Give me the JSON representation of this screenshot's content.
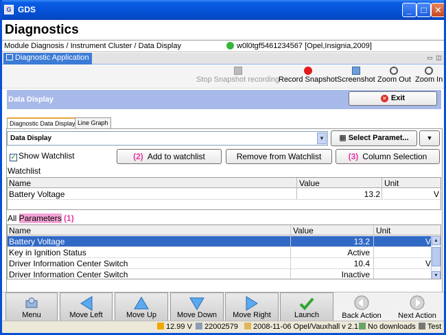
{
  "window": {
    "title": "GDS",
    "app_icon": "app-icon"
  },
  "header": {
    "title": "Diagnostics",
    "breadcrumb": "Module Diagnosis / Instrument Cluster / Data Display",
    "vehicle": "w0l0tgf5461234567 [Opel,Insignia,2009]"
  },
  "app_tab": {
    "label": "Diagnostic Application"
  },
  "toolbar": {
    "stop_snapshot": "Stop Snapshot recording",
    "record_snapshot": "Record Snapshot",
    "screenshot": "Screenshot",
    "zoom_out": "Zoom Out",
    "zoom_in": "Zoom In"
  },
  "section": {
    "title": "Data Display",
    "exit_label": "Exit"
  },
  "subtabs": [
    "Diagnostic Data Display",
    "Line Graph"
  ],
  "selector": {
    "value": "Data Display",
    "select_params_label": "Select Paramet..."
  },
  "controls": {
    "show_watchlist": "Show Watchlist",
    "add_watchlist": "Add to watchlist",
    "add_watchlist_tag": "(2)",
    "remove_watchlist": "Remove from Watchlist",
    "column_selection": "Column Selection",
    "column_selection_tag": "(3)"
  },
  "watchlist": {
    "label": "Watchlist",
    "columns": [
      "Name",
      "Value",
      "Unit"
    ],
    "rows": [
      {
        "name": "Battery Voltage",
        "value": "13.2",
        "unit": "V"
      }
    ]
  },
  "all_params": {
    "label_prefix": "All ",
    "label_highlight": "Parameters",
    "tag": "(1)",
    "columns": [
      "Name",
      "Value",
      "Unit"
    ],
    "rows": [
      {
        "name": "Battery Voltage",
        "value": "13.2",
        "unit": "V"
      },
      {
        "name": "Key in Ignition Status",
        "value": "Active",
        "unit": ""
      },
      {
        "name": "Driver Information Center Switch",
        "value": "10.4",
        "unit": "V"
      },
      {
        "name": "Driver Information Center Switch",
        "value": "Inactive",
        "unit": ""
      }
    ]
  },
  "nav": {
    "menu": "Menu",
    "move_left": "Move Left",
    "move_up": "Move Up",
    "move_down": "Move Down",
    "move_right": "Move Right",
    "launch": "Launch",
    "back_action": "Back Action",
    "next_action": "Next Action"
  },
  "status": {
    "voltage": "12.99 V",
    "device": "22002579",
    "version": "2008-11-06 Opel/Vauxhall v 2.1",
    "downloads": "No downloads",
    "mode": "Test"
  },
  "colors": {
    "title_blue": "#0553d8",
    "section_bar": "#a7b9e8",
    "selected_row": "#3169c6",
    "annotation": "#e637a1",
    "highlight": "#f3a3d6"
  }
}
